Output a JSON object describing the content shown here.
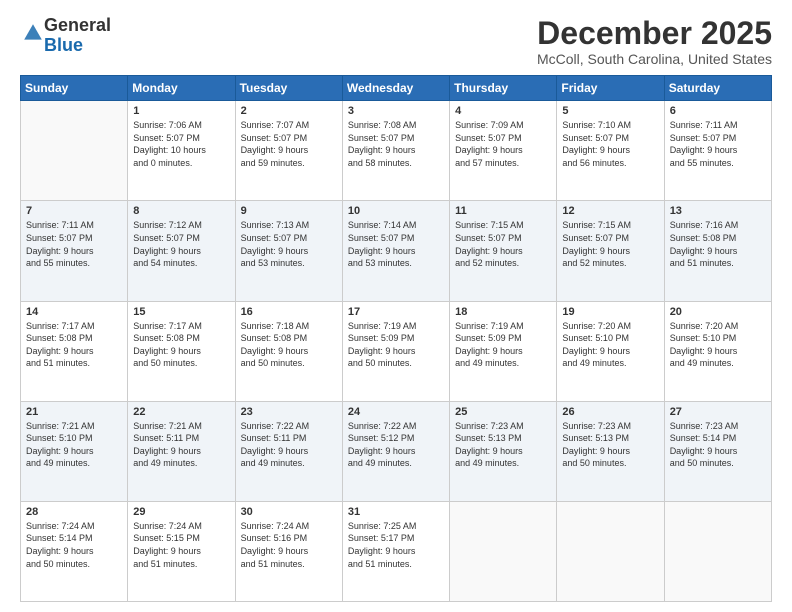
{
  "header": {
    "logo_general": "General",
    "logo_blue": "Blue",
    "month_year": "December 2025",
    "location": "McColl, South Carolina, United States"
  },
  "weekdays": [
    "Sunday",
    "Monday",
    "Tuesday",
    "Wednesday",
    "Thursday",
    "Friday",
    "Saturday"
  ],
  "rows": [
    [
      {
        "day": "",
        "info": ""
      },
      {
        "day": "1",
        "info": "Sunrise: 7:06 AM\nSunset: 5:07 PM\nDaylight: 10 hours\nand 0 minutes."
      },
      {
        "day": "2",
        "info": "Sunrise: 7:07 AM\nSunset: 5:07 PM\nDaylight: 9 hours\nand 59 minutes."
      },
      {
        "day": "3",
        "info": "Sunrise: 7:08 AM\nSunset: 5:07 PM\nDaylight: 9 hours\nand 58 minutes."
      },
      {
        "day": "4",
        "info": "Sunrise: 7:09 AM\nSunset: 5:07 PM\nDaylight: 9 hours\nand 57 minutes."
      },
      {
        "day": "5",
        "info": "Sunrise: 7:10 AM\nSunset: 5:07 PM\nDaylight: 9 hours\nand 56 minutes."
      },
      {
        "day": "6",
        "info": "Sunrise: 7:11 AM\nSunset: 5:07 PM\nDaylight: 9 hours\nand 55 minutes."
      }
    ],
    [
      {
        "day": "7",
        "info": "Sunrise: 7:11 AM\nSunset: 5:07 PM\nDaylight: 9 hours\nand 55 minutes."
      },
      {
        "day": "8",
        "info": "Sunrise: 7:12 AM\nSunset: 5:07 PM\nDaylight: 9 hours\nand 54 minutes."
      },
      {
        "day": "9",
        "info": "Sunrise: 7:13 AM\nSunset: 5:07 PM\nDaylight: 9 hours\nand 53 minutes."
      },
      {
        "day": "10",
        "info": "Sunrise: 7:14 AM\nSunset: 5:07 PM\nDaylight: 9 hours\nand 53 minutes."
      },
      {
        "day": "11",
        "info": "Sunrise: 7:15 AM\nSunset: 5:07 PM\nDaylight: 9 hours\nand 52 minutes."
      },
      {
        "day": "12",
        "info": "Sunrise: 7:15 AM\nSunset: 5:07 PM\nDaylight: 9 hours\nand 52 minutes."
      },
      {
        "day": "13",
        "info": "Sunrise: 7:16 AM\nSunset: 5:08 PM\nDaylight: 9 hours\nand 51 minutes."
      }
    ],
    [
      {
        "day": "14",
        "info": "Sunrise: 7:17 AM\nSunset: 5:08 PM\nDaylight: 9 hours\nand 51 minutes."
      },
      {
        "day": "15",
        "info": "Sunrise: 7:17 AM\nSunset: 5:08 PM\nDaylight: 9 hours\nand 50 minutes."
      },
      {
        "day": "16",
        "info": "Sunrise: 7:18 AM\nSunset: 5:08 PM\nDaylight: 9 hours\nand 50 minutes."
      },
      {
        "day": "17",
        "info": "Sunrise: 7:19 AM\nSunset: 5:09 PM\nDaylight: 9 hours\nand 50 minutes."
      },
      {
        "day": "18",
        "info": "Sunrise: 7:19 AM\nSunset: 5:09 PM\nDaylight: 9 hours\nand 49 minutes."
      },
      {
        "day": "19",
        "info": "Sunrise: 7:20 AM\nSunset: 5:10 PM\nDaylight: 9 hours\nand 49 minutes."
      },
      {
        "day": "20",
        "info": "Sunrise: 7:20 AM\nSunset: 5:10 PM\nDaylight: 9 hours\nand 49 minutes."
      }
    ],
    [
      {
        "day": "21",
        "info": "Sunrise: 7:21 AM\nSunset: 5:10 PM\nDaylight: 9 hours\nand 49 minutes."
      },
      {
        "day": "22",
        "info": "Sunrise: 7:21 AM\nSunset: 5:11 PM\nDaylight: 9 hours\nand 49 minutes."
      },
      {
        "day": "23",
        "info": "Sunrise: 7:22 AM\nSunset: 5:11 PM\nDaylight: 9 hours\nand 49 minutes."
      },
      {
        "day": "24",
        "info": "Sunrise: 7:22 AM\nSunset: 5:12 PM\nDaylight: 9 hours\nand 49 minutes."
      },
      {
        "day": "25",
        "info": "Sunrise: 7:23 AM\nSunset: 5:13 PM\nDaylight: 9 hours\nand 49 minutes."
      },
      {
        "day": "26",
        "info": "Sunrise: 7:23 AM\nSunset: 5:13 PM\nDaylight: 9 hours\nand 50 minutes."
      },
      {
        "day": "27",
        "info": "Sunrise: 7:23 AM\nSunset: 5:14 PM\nDaylight: 9 hours\nand 50 minutes."
      }
    ],
    [
      {
        "day": "28",
        "info": "Sunrise: 7:24 AM\nSunset: 5:14 PM\nDaylight: 9 hours\nand 50 minutes."
      },
      {
        "day": "29",
        "info": "Sunrise: 7:24 AM\nSunset: 5:15 PM\nDaylight: 9 hours\nand 51 minutes."
      },
      {
        "day": "30",
        "info": "Sunrise: 7:24 AM\nSunset: 5:16 PM\nDaylight: 9 hours\nand 51 minutes."
      },
      {
        "day": "31",
        "info": "Sunrise: 7:25 AM\nSunset: 5:17 PM\nDaylight: 9 hours\nand 51 minutes."
      },
      {
        "day": "",
        "info": ""
      },
      {
        "day": "",
        "info": ""
      },
      {
        "day": "",
        "info": ""
      }
    ]
  ]
}
